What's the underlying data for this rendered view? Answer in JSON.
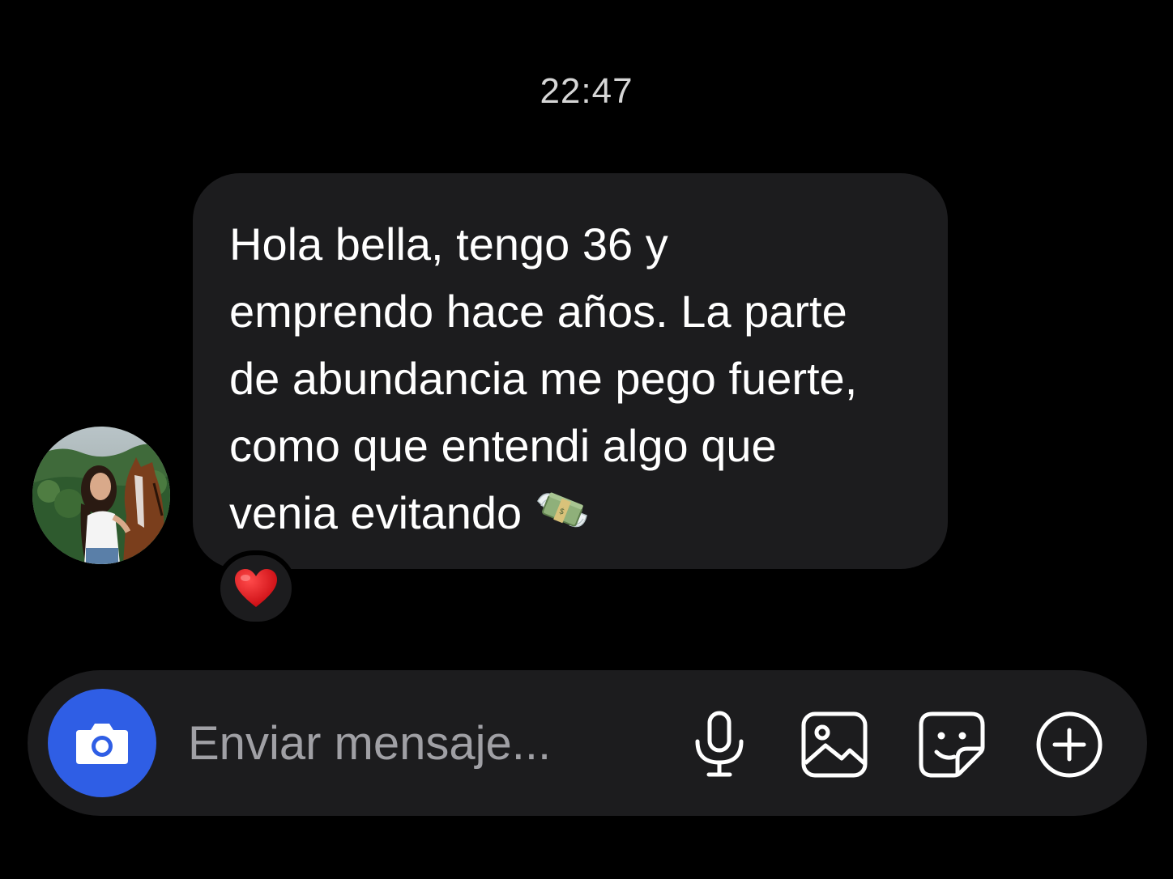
{
  "conversation": {
    "timestamp": "22:47",
    "message": {
      "text": "Hola bella, tengo 36 y\nemprendo hace años. La parte\nde abundancia me pego fuerte,\ncomo que entendi algo que\nvenia evitando",
      "trailing_emoji": "money-with-wings-emoji",
      "reaction": "red-heart-emoji"
    },
    "sender": {
      "avatar": "profile-photo"
    }
  },
  "composer": {
    "placeholder": "Enviar mensaje...",
    "camera_icon": "camera-icon",
    "mic_icon": "microphone-icon",
    "gallery_icon": "image-icon",
    "sticker_icon": "sticker-icon",
    "add_icon": "plus-circle-icon",
    "accent_color": "#2f5ee5"
  }
}
